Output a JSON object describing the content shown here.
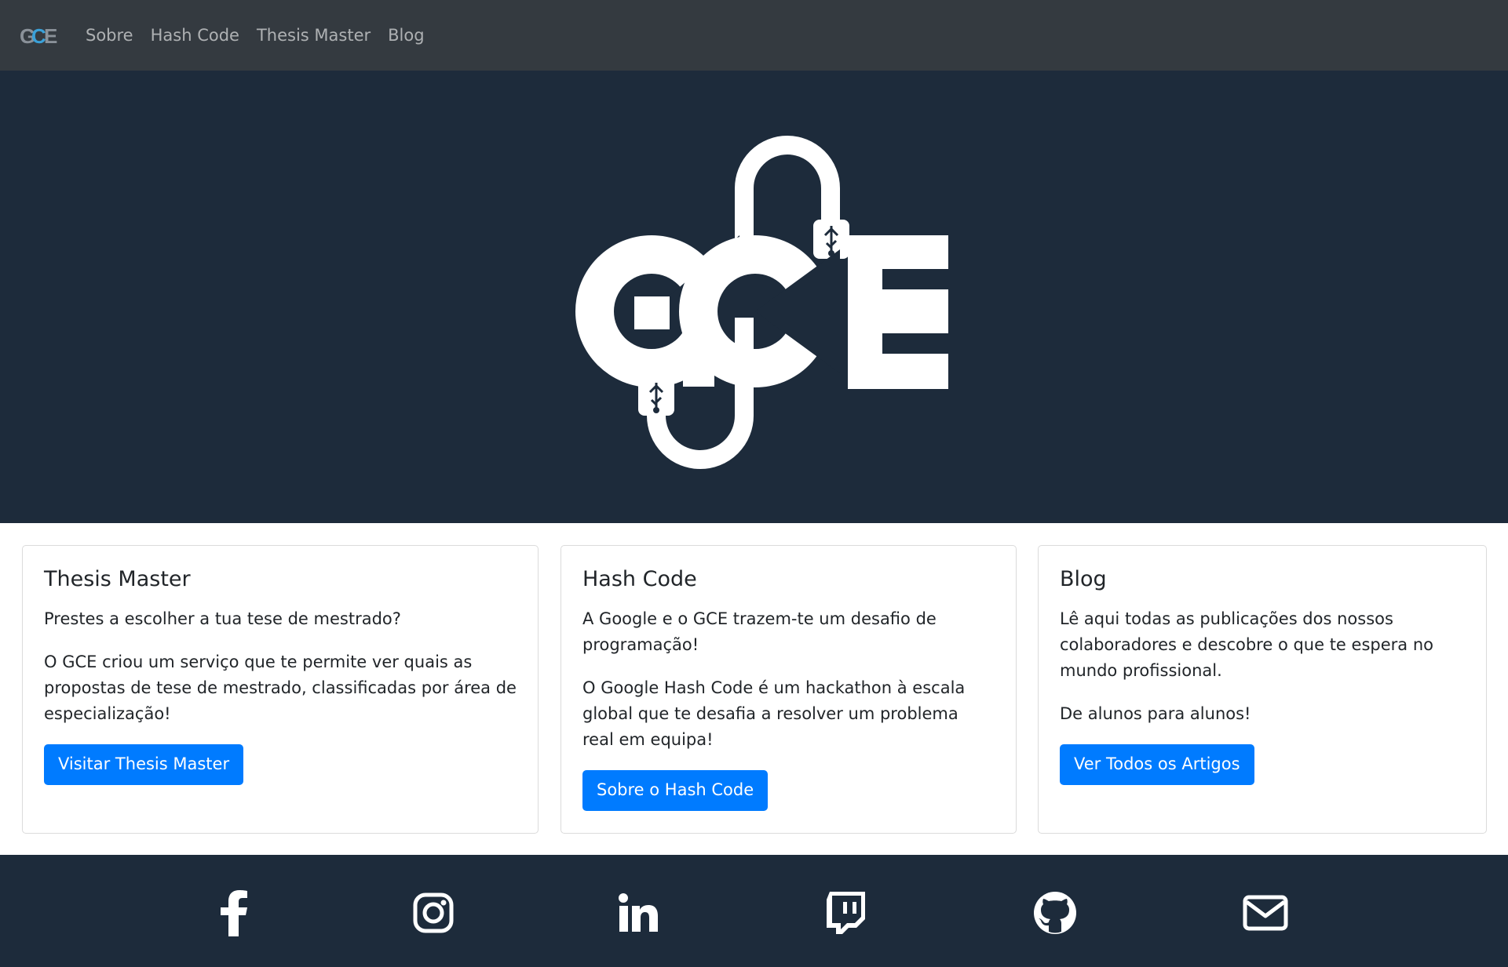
{
  "nav": {
    "brand_icon": "gce-logo-icon",
    "items": [
      {
        "label": "Sobre"
      },
      {
        "label": "Hash Code"
      },
      {
        "label": "Thesis Master"
      },
      {
        "label": "Blog"
      }
    ]
  },
  "hero": {
    "logo_text": "GCE",
    "logo_icon": "gce-usb-cable-logo"
  },
  "cards": [
    {
      "title": "Thesis Master",
      "paragraphs": [
        "Prestes a escolher a tua tese de mestrado?",
        "O GCE criou um serviço que te permite ver quais as propostas de tese de mestrado, classificadas por área de especialização!"
      ],
      "button": "Visitar Thesis Master"
    },
    {
      "title": "Hash Code",
      "paragraphs": [
        "A Google e o GCE trazem-te um desafio de programação!",
        "O Google Hash Code é um hackathon à escala global que te desafia a resolver um problema real em equipa!"
      ],
      "button": "Sobre o Hash Code"
    },
    {
      "title": "Blog",
      "paragraphs": [
        "Lê aqui todas as publicações dos nossos colaboradores e descobre o que te espera no mundo profissional.",
        "De alunos para alunos!"
      ],
      "button": "Ver Todos os Artigos"
    }
  ],
  "footer": {
    "social_icons": [
      "facebook-icon",
      "instagram-icon",
      "linkedin-icon",
      "twitch-icon",
      "github-icon",
      "email-icon"
    ]
  },
  "colors": {
    "navbar": "#343a40",
    "hero_bg": "#1d2b3b",
    "primary": "#007bff",
    "footer_bg": "#1d2b3b"
  }
}
